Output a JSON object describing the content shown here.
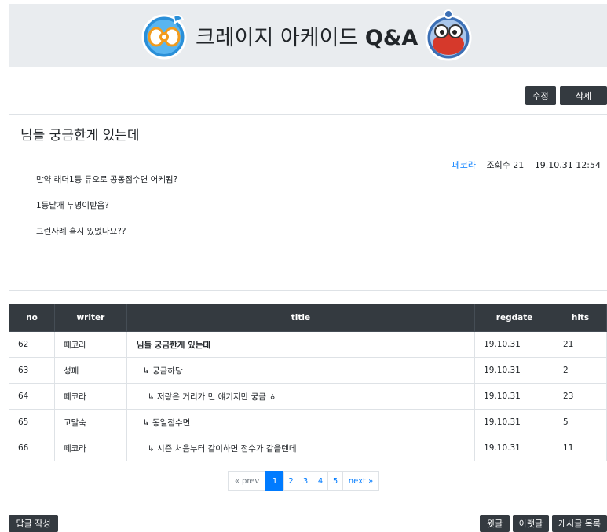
{
  "banner": {
    "title": "크레이지 아케이드",
    "title_suffix": "Q&A"
  },
  "actions": {
    "edit": "수정",
    "delete": "삭제"
  },
  "post": {
    "title": "님들 궁금한게 있는데",
    "author": "페코라",
    "views": "조회수 21",
    "datetime": "19.10.31 12:54",
    "body": [
      "만약 래더1등 듀오로 공동점수면 어케됨?",
      "1등낱개 두명이받음?",
      "그런사례 혹시 있었나요??"
    ]
  },
  "table": {
    "headers": [
      "no",
      "writer",
      "title",
      "regdate",
      "hits"
    ],
    "rows": [
      {
        "no": "62",
        "writer": "페코라",
        "title": "님들 궁금한게 있는데",
        "regdate": "19.10.31",
        "hits": "21"
      },
      {
        "no": "63",
        "writer": "성패",
        "title": "↳ 궁금하당",
        "regdate": "19.10.31",
        "hits": "2"
      },
      {
        "no": "64",
        "writer": "페코라",
        "title": "↳ 저랑은 거리가 먼 얘기지만 궁금 ㅎ",
        "regdate": "19.10.31",
        "hits": "23"
      },
      {
        "no": "65",
        "writer": "고말숙",
        "title": "↳ 동일점수면",
        "regdate": "19.10.31",
        "hits": "5"
      },
      {
        "no": "66",
        "writer": "페코라",
        "title": "↳ 시즌 처음부터 같이하면 점수가 같을텐데",
        "regdate": "19.10.31",
        "hits": "11"
      }
    ]
  },
  "pagination": {
    "prev": "« prev",
    "pages": [
      "1",
      "2",
      "3",
      "4",
      "5"
    ],
    "active": "1",
    "next": "next »"
  },
  "footer": {
    "reply": "답글 작성",
    "prev_post": "윗글",
    "next_post": "아랫글",
    "list": "게시글 목록"
  },
  "colors": {
    "dark": "#343a40",
    "link": "#007bff",
    "banner_bg": "#e9ecef"
  }
}
